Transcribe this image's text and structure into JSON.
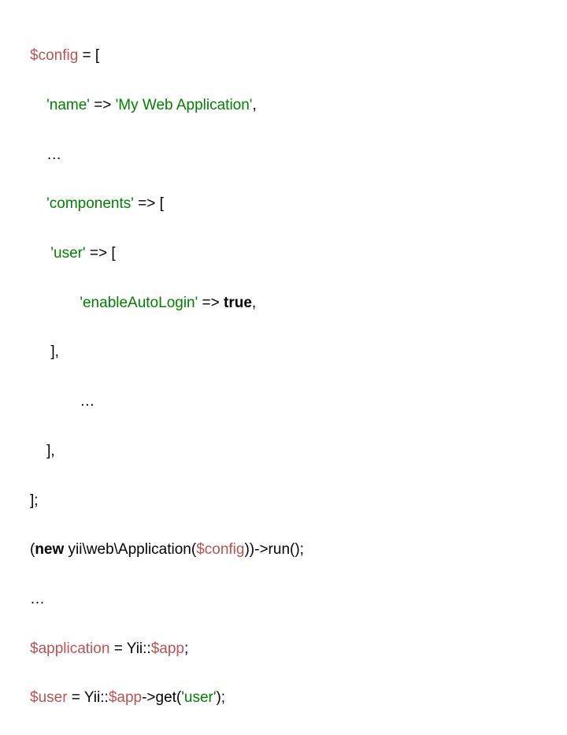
{
  "code": {
    "l1": {
      "var": "$config",
      "rest": " = ["
    },
    "l2": {
      "pad": "    ",
      "str": "'name'",
      "arrow": " => ",
      "val": "'My Web Application'",
      "comma": ","
    },
    "l3": {
      "pad": "    ",
      "text": "…"
    },
    "l4": {
      "pad": "    ",
      "str": "'components'",
      "rest": " => ["
    },
    "l5": {
      "pad": "     ",
      "str": "'user'",
      "rest": " => ["
    },
    "l6": {
      "pad": "            ",
      "str": "'enableAutoLogin'",
      "arrow": " => ",
      "kw": "true",
      "comma": ","
    },
    "l7": {
      "pad": "     ",
      "text": "],"
    },
    "l8": {
      "pad": "            ",
      "text": "…"
    },
    "l9": {
      "pad": "    ",
      "text": "],"
    },
    "l10": {
      "text": "];"
    },
    "l11": {
      "a": "(",
      "kw": "new",
      "b": " yii\\web\\Application(",
      "var": "$config",
      "c": "))->run();"
    },
    "l12": {
      "text": "…"
    },
    "l13": {
      "var": "$application",
      "eq": " = Yii::",
      "var2": "$app",
      "semi": ";"
    },
    "l14": {
      "var": "$user",
      "eq": " = Yii::",
      "var2": "$app",
      "mid": "->get(",
      "str": "'user'",
      "end": ");"
    }
  }
}
